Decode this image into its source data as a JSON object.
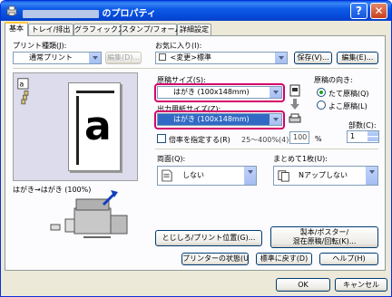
{
  "window": {
    "title_suffix": "のプロパティ",
    "help_label": "?",
    "close_label": "✕"
  },
  "tabs": [
    {
      "label": "基本"
    },
    {
      "label": "トレイ/排出"
    },
    {
      "label": "グラフィックス"
    },
    {
      "label": "スタンプ/フォーム"
    },
    {
      "label": "詳細設定"
    }
  ],
  "print_type": {
    "label": "プリント種類(J):",
    "value": "通常プリント",
    "edit_label": "編集(D)..."
  },
  "favorites": {
    "label": "お気に入り(I):",
    "value": "<変更>標準",
    "save_label": "保存(V)...",
    "edit_label": "編集(E)..."
  },
  "preview": {
    "caption": "はがき→はがき (100%)",
    "letter": "a"
  },
  "original_size": {
    "label": "原稿サイズ(S):",
    "value": "はがき (100x148mm)"
  },
  "output_size": {
    "label": "出力用紙サイズ(Z):",
    "value": "はがき (100x148mm)"
  },
  "orientation": {
    "label": "原稿の向き:",
    "portrait": "たて原稿(Q)",
    "landscape": "よこ原稿(L)"
  },
  "copies": {
    "label": "部数(C):",
    "value": "1"
  },
  "scale": {
    "label": "倍率を指定する(R)",
    "range": "25〜400%(4):",
    "value": "100",
    "unit": "%"
  },
  "duplex": {
    "label": "両面(Q):",
    "value": "しない"
  },
  "nup": {
    "label": "まとめて1枚(U):",
    "value": "Nアップしない"
  },
  "buttons": {
    "binding": "とじしろ/プリント位置(G)...",
    "booklet": "製本/ポスター/\n混在原稿/回転(K)...",
    "printer_status": "プリンターの状態(U)",
    "defaults": "標準に戻す(D)",
    "help": "ヘルプ(H)",
    "ok": "OK",
    "cancel": "キャンセル"
  }
}
